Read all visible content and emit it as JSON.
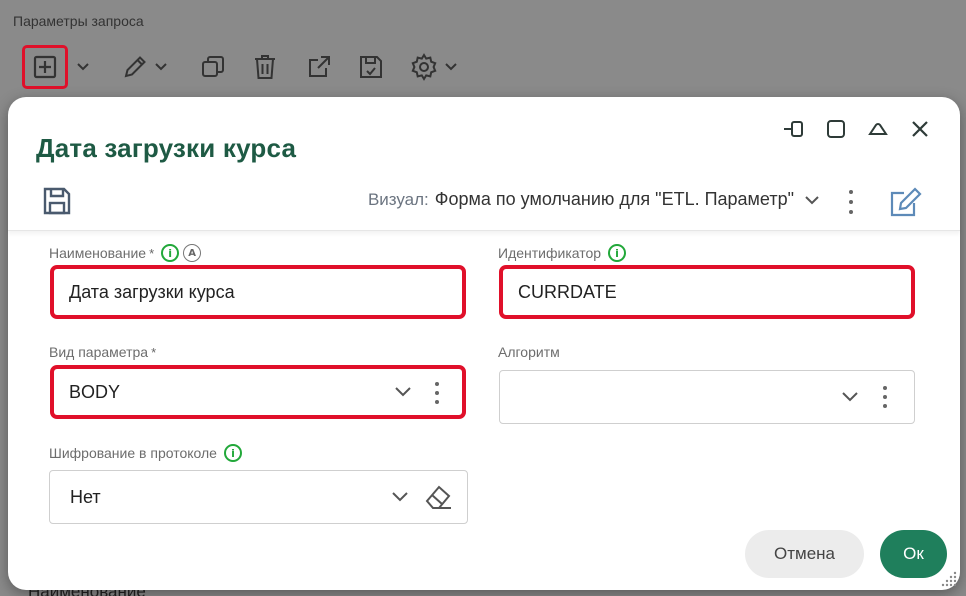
{
  "background": {
    "section_title": "Параметры запроса",
    "bottom_text": "Наименование"
  },
  "toolbar_icons": [
    "add-icon",
    "pencil-icon",
    "copy-icon",
    "trash-icon",
    "external-link-icon",
    "save-icon",
    "gear-icon"
  ],
  "dialog": {
    "title": "Дата загрузки курса",
    "visual_label": "Визуал:",
    "visual_value": "Форма по умолчанию для \"ETL. Параметр\"",
    "fields": {
      "name": {
        "label": "Наименование",
        "required_mark": "*",
        "value": "Дата загрузки курса"
      },
      "identifier": {
        "label": "Идентификатор",
        "value": "CURRDATE"
      },
      "param_type": {
        "label": "Вид параметра",
        "required_mark": "*",
        "value": "BODY"
      },
      "algorithm": {
        "label": "Алгоритм",
        "value": ""
      },
      "encryption": {
        "label": "Шифрование в протоколе",
        "value": "Нет"
      }
    },
    "info_glyph": "i",
    "auto_glyph": "A",
    "cancel_label": "Отмена",
    "ok_label": "Ок"
  },
  "colors": {
    "accent_green": "#1f7f5c",
    "title_green": "#1e5a44",
    "highlight_red": "#e0102a",
    "info_green": "#22a83a"
  }
}
